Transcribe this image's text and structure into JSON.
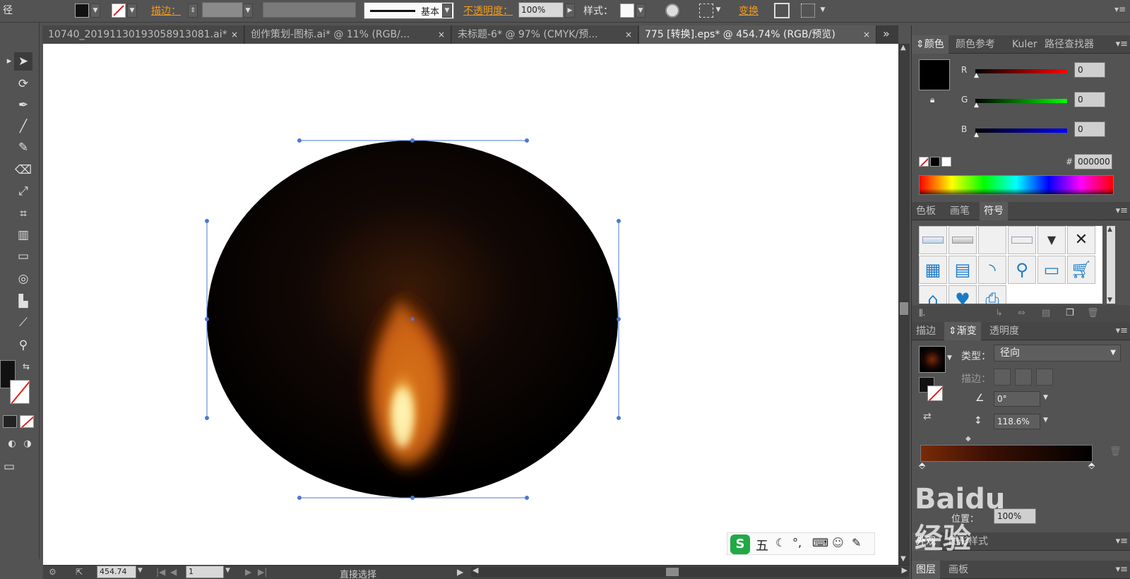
{
  "control_bar": {
    "path_label": "径",
    "stroke_label": "描边：",
    "brush_label": "基本",
    "opacity_label": "不透明度：",
    "opacity_value": "100%",
    "style_label": "样式：",
    "transform_label": "变换"
  },
  "tabs": [
    {
      "label": "10740_20191130193058913081.ai*",
      "close": "×"
    },
    {
      "label": "创作策划-图标.ai* @ 11% (RGB/...",
      "close": "×"
    },
    {
      "label": "未标题-6* @ 97% (CMYK/预...",
      "close": "×"
    },
    {
      "label": "775 [转换].eps* @ 454.74% (RGB/预览)",
      "close": "×"
    }
  ],
  "tab_overflow": "»",
  "status_bar": {
    "zoom": "454.74",
    "page": "1",
    "tool_name": "直接选择"
  },
  "color_panel": {
    "tabs": [
      "颜色",
      "颜色参考",
      "Kuler",
      "路径查找器"
    ],
    "r_label": "R",
    "r_value": "0",
    "g_label": "G",
    "g_value": "0",
    "b_label": "B",
    "b_value": "0",
    "hex_label": "#",
    "hex_value": "000000"
  },
  "swatch_panel": {
    "tabs": [
      "色板",
      "画笔",
      "符号"
    ]
  },
  "gradient_panel": {
    "tabs": [
      "描边",
      "渐变",
      "透明度"
    ],
    "type_label": "类型：",
    "type_value": "径向",
    "stroke_label": "描边：",
    "angle_value": "0°",
    "aspect_value": "118.6%",
    "position_label": "位置：",
    "position_value": "100%"
  },
  "appearance_panel": {
    "tabs": [
      "外观",
      "图形样式"
    ]
  },
  "layers_panel": {
    "tabs": [
      "图层",
      "画板"
    ]
  },
  "ime_bar": {
    "mode": "五"
  },
  "watermark": {
    "text": "Baidu 经验"
  },
  "colors": {
    "orange_accent": "#f29b1d",
    "flame_core": "#fff0a0",
    "flame_mid": "#f0901e",
    "flame_outer": "#9c3a08",
    "ellipse_fill": "#000000",
    "selection_blue": "#4a78d8"
  }
}
